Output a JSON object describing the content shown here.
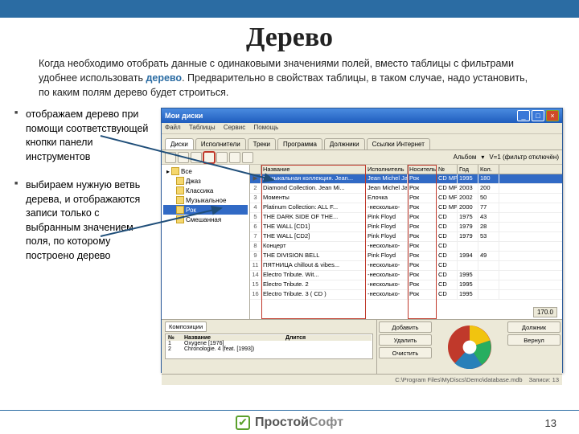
{
  "slide": {
    "title": "Дерево",
    "intro_a": "Когда необходимо отобрать данные с одинаковыми значениями полей, вместо таблицы с фильтрами удобнее использовать ",
    "intro_kw": "дерево",
    "intro_b": ". Предварительно в свойствах таблицы, в таком случае, надо установить, по каким полям дерево будет строиться.",
    "bullet1": "отображаем дерево при помощи соответствующей кнопки панели инструментов",
    "bullet2": "выбираем нужную ветвь дерева, и отображаются записи только с выбранным значением поля, по которому построено дерево",
    "page_num": "13"
  },
  "window": {
    "title": "Мои диски",
    "menus": [
      "Файл",
      "Таблицы",
      "Сервис",
      "Помощь"
    ],
    "tabs": [
      "Диски",
      "Исполнители",
      "Треки",
      "Программа",
      "Должники",
      "Ссылки Интернет"
    ],
    "active_tab": 0,
    "filter_label": "Альбом",
    "filter_value": "V=1 (фильтр отключён)",
    "tree_root": "Все",
    "tree_nodes": [
      "Джаз",
      "Классика",
      "Музыкальное",
      "Рок",
      "Смешанная"
    ],
    "tree_selected": 3,
    "grid_columns": [
      "",
      "Название",
      "Исполнитель",
      "Носитель",
      "№",
      "Год",
      "Кол."
    ],
    "rows": [
      {
        "n": "▶",
        "t": "Музыкальная коллекция. Jean...",
        "a": "Jean Michel Jarre",
        "m": "Рок",
        "c": "CD MP3",
        "y": "1995",
        "k": "180"
      },
      {
        "n": "2",
        "t": "Diamond Collection. Jean Mi...",
        "a": "Jean Michel Jarre",
        "m": "Рок",
        "c": "CD MP3",
        "y": "2003",
        "k": "200"
      },
      {
        "n": "3",
        "t": "Моменты",
        "a": "Елочка",
        "m": "Рок",
        "c": "CD MP3",
        "y": "2002",
        "k": "50"
      },
      {
        "n": "4",
        "t": "Platinum Collection: ALL F...",
        "a": "-несколько-",
        "m": "Рок",
        "c": "CD MP3",
        "y": "2000",
        "k": "77"
      },
      {
        "n": "5",
        "t": "THE DARK SIDE OF THE...",
        "a": "Pink Floyd",
        "m": "Рок",
        "c": "CD",
        "y": "1975",
        "k": "43"
      },
      {
        "n": "6",
        "t": "THE WALL [CD1]",
        "a": "Pink Floyd",
        "m": "Рок",
        "c": "CD",
        "y": "1979",
        "k": "28"
      },
      {
        "n": "7",
        "t": "THE WALL [CD2]",
        "a": "Pink Floyd",
        "m": "Рок",
        "c": "CD",
        "y": "1979",
        "k": "53"
      },
      {
        "n": "8",
        "t": "Концерт",
        "a": "-несколько-",
        "m": "Рок",
        "c": "CD",
        "y": "",
        "k": ""
      },
      {
        "n": "9",
        "t": "THE DIVISION BELL",
        "a": "Pink Floyd",
        "m": "Рок",
        "c": "CD",
        "y": "1994",
        "k": "49"
      },
      {
        "n": "11",
        "t": "ПЯТНИЦА chillout & vibes...",
        "a": "-несколько-",
        "m": "Рок",
        "c": "CD",
        "y": "",
        "k": ""
      },
      {
        "n": "14",
        "t": "Electro Tribute. Wit...",
        "a": "-несколько-",
        "m": "Рок",
        "c": "CD",
        "y": "1995",
        "k": ""
      },
      {
        "n": "15",
        "t": "Electro Tribute. 2",
        "a": "-несколько-",
        "m": "Рок",
        "c": "CD",
        "y": "1995",
        "k": ""
      },
      {
        "n": "16",
        "t": "Electro Tribute. 3 ( CD )",
        "a": "-несколько-",
        "m": "Рок",
        "c": "CD",
        "y": "1995",
        "k": ""
      }
    ],
    "sel_row": 0,
    "sum_value": "170.0",
    "sub_tabs": [
      "Композиции"
    ],
    "sub_columns": [
      "№",
      "Название",
      "Длится"
    ],
    "sub_rows": [
      {
        "n": "1",
        "t": "Oxygene [1976]",
        "d": ""
      },
      {
        "n": "2",
        "t": "Chronologie. 4 (feat. [1993])",
        "d": ""
      }
    ],
    "buttons": [
      "Добавить",
      "Удалить",
      "Очистить"
    ],
    "buttons2": [
      "Должник",
      "Вернул"
    ],
    "status_path": "C:\\Program Files\\MyDiscs\\Demo\\database.mdb",
    "status_rec": "Записи: 13"
  },
  "footer": {
    "brand_a": "Простой",
    "brand_b": "Софт"
  }
}
